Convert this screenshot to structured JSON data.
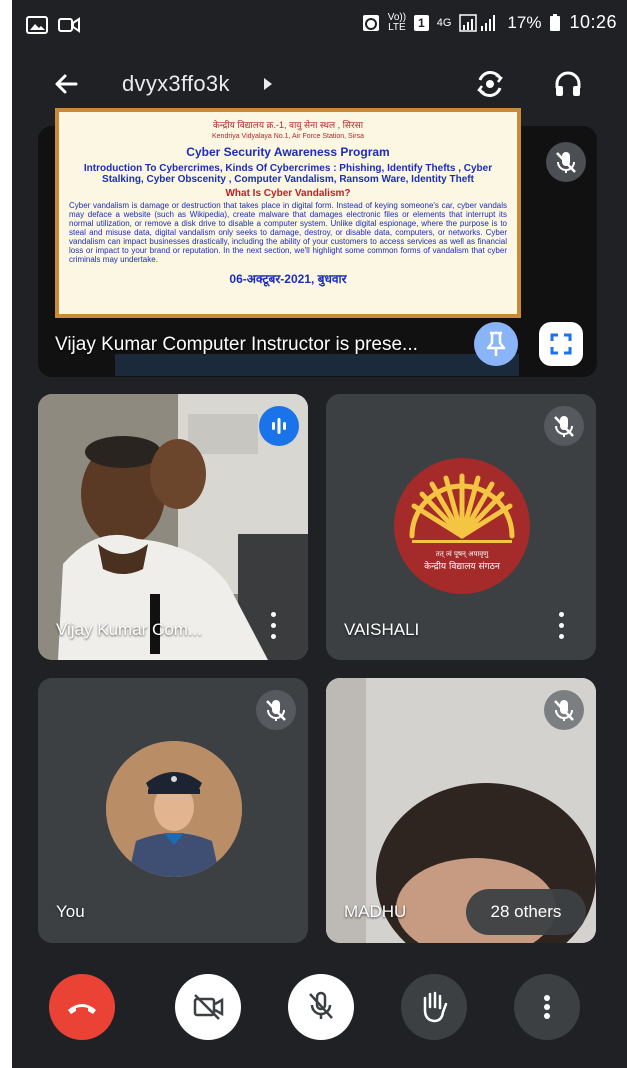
{
  "status_bar": {
    "network_label_top": "Vo))",
    "network_label_bottom": "LTE",
    "sim": "1",
    "signal_type": "4G",
    "battery": "17%",
    "time": "10:26"
  },
  "header": {
    "meeting_code": "dvyx3ffo3k"
  },
  "presentation": {
    "slide": {
      "school_hindi": "केन्द्रीय विद्यालय क्र.-1, वायु सेना स्थल , सिरसा",
      "school_english": "Kendriya Vidyalaya No.1, Air Force Station, Sirsa",
      "title": "Cyber Security Awareness Program",
      "topics": "Introduction To Cybercrimes, Kinds Of Cybercrimes : Phishing, Identify Thefts , Cyber Stalking, Cyber Obscenity , Computer Vandalism, Ransom Ware, Identity Theft",
      "question": "What Is Cyber Vandalism?",
      "body": "Cyber vandalism is damage or destruction that takes place in digital form. Instead of keying someone's car, cyber vandals may deface a website (such as Wikipedia), create malware that damages electronic files or elements that interrupt its normal utilization, or remove a disk drive to disable a computer system. Unlike digital espionage, where the purpose is to steal and misuse data, digital vandalism only seeks to damage, destroy, or disable data, computers, or networks. Cyber vandalism can impact businesses drastically, including the ability of your customers to access services as well as financial loss or impact to your brand or reputation. In the next section, we'll highlight some common forms of vandalism that cyber criminals may undertake.",
      "date": "06-अक्टूबर-2021, बुधवार"
    },
    "label": "Vijay Kumar Computer Instructor is prese..."
  },
  "participants": {
    "vijay": {
      "name": "Vijay Kumar Com..."
    },
    "vaishali": {
      "name": "VAISHALI",
      "logo_text_top": "तत् त्वं पूषन् अपावृणु",
      "logo_text_bottom": "केन्द्रीय विद्यालय संगठन"
    },
    "you": {
      "name": "You"
    },
    "madhu": {
      "name": "MADHU",
      "others": "28 others"
    }
  },
  "icons": {
    "back": "arrow-left-icon",
    "switch_camera": "switch-camera-icon",
    "audio": "headphones-icon",
    "mic_off": "mic-off-icon",
    "pin": "pin-icon",
    "fullscreen": "fullscreen-icon",
    "speaking": "audio-level-icon",
    "more": "more-vertical-icon",
    "end_call": "end-call-icon",
    "camera_off": "camera-off-icon",
    "raise_hand": "raise-hand-icon"
  },
  "colors": {
    "background": "#202124",
    "tile": "#3c4043",
    "end_call": "#ea4335",
    "accent_blue": "#8ab4f8",
    "speaking_blue": "#1a73e8",
    "kvs_logo_red": "#a52a2a",
    "kvs_logo_yellow": "#f4c542"
  }
}
